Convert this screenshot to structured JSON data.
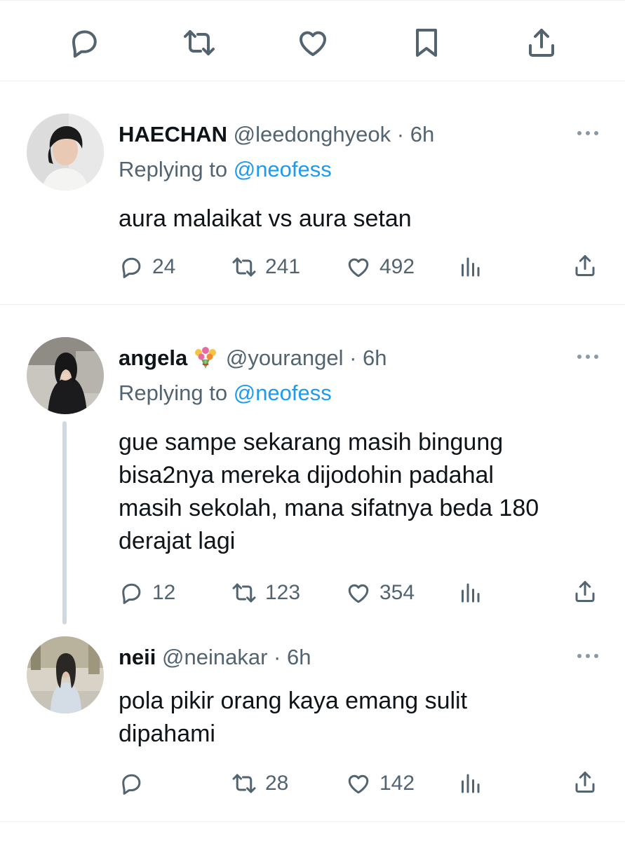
{
  "action_bar": {
    "icons": [
      "reply-icon",
      "retweet-icon",
      "like-icon",
      "bookmark-icon",
      "share-icon"
    ]
  },
  "tweets": [
    {
      "name": "HAECHAN",
      "handle": "@leedonghyeok",
      "separator": "·",
      "time": "6h",
      "replying_prefix": "Replying to",
      "replying_to": "@neofess",
      "text": "aura malaikat vs aura setan",
      "replies": "24",
      "retweets": "241",
      "likes": "492"
    },
    {
      "name": "angela",
      "name_emoji": "bouquet-emoji",
      "handle": "@yourangel",
      "separator": "·",
      "time": "6h",
      "replying_prefix": "Replying to",
      "replying_to": "@neofess",
      "text": "gue sampe sekarang masih bingung\nbisa2nya mereka dijodohin padahal\nmasih sekolah, mana sifatnya beda 180\nderajat lagi",
      "replies": "12",
      "retweets": "123",
      "likes": "354"
    },
    {
      "name": "neii",
      "handle": "@neinakar",
      "separator": "·",
      "time": "6h",
      "text": "pola pikir orang kaya emang sulit\ndipahami",
      "replies": "",
      "retweets": "28",
      "likes": "142"
    }
  ],
  "colors": {
    "text": "#0f1419",
    "secondary": "#536471",
    "accent": "#1d9bf0",
    "divider": "#eff3f4",
    "thread": "#cfd9de"
  }
}
